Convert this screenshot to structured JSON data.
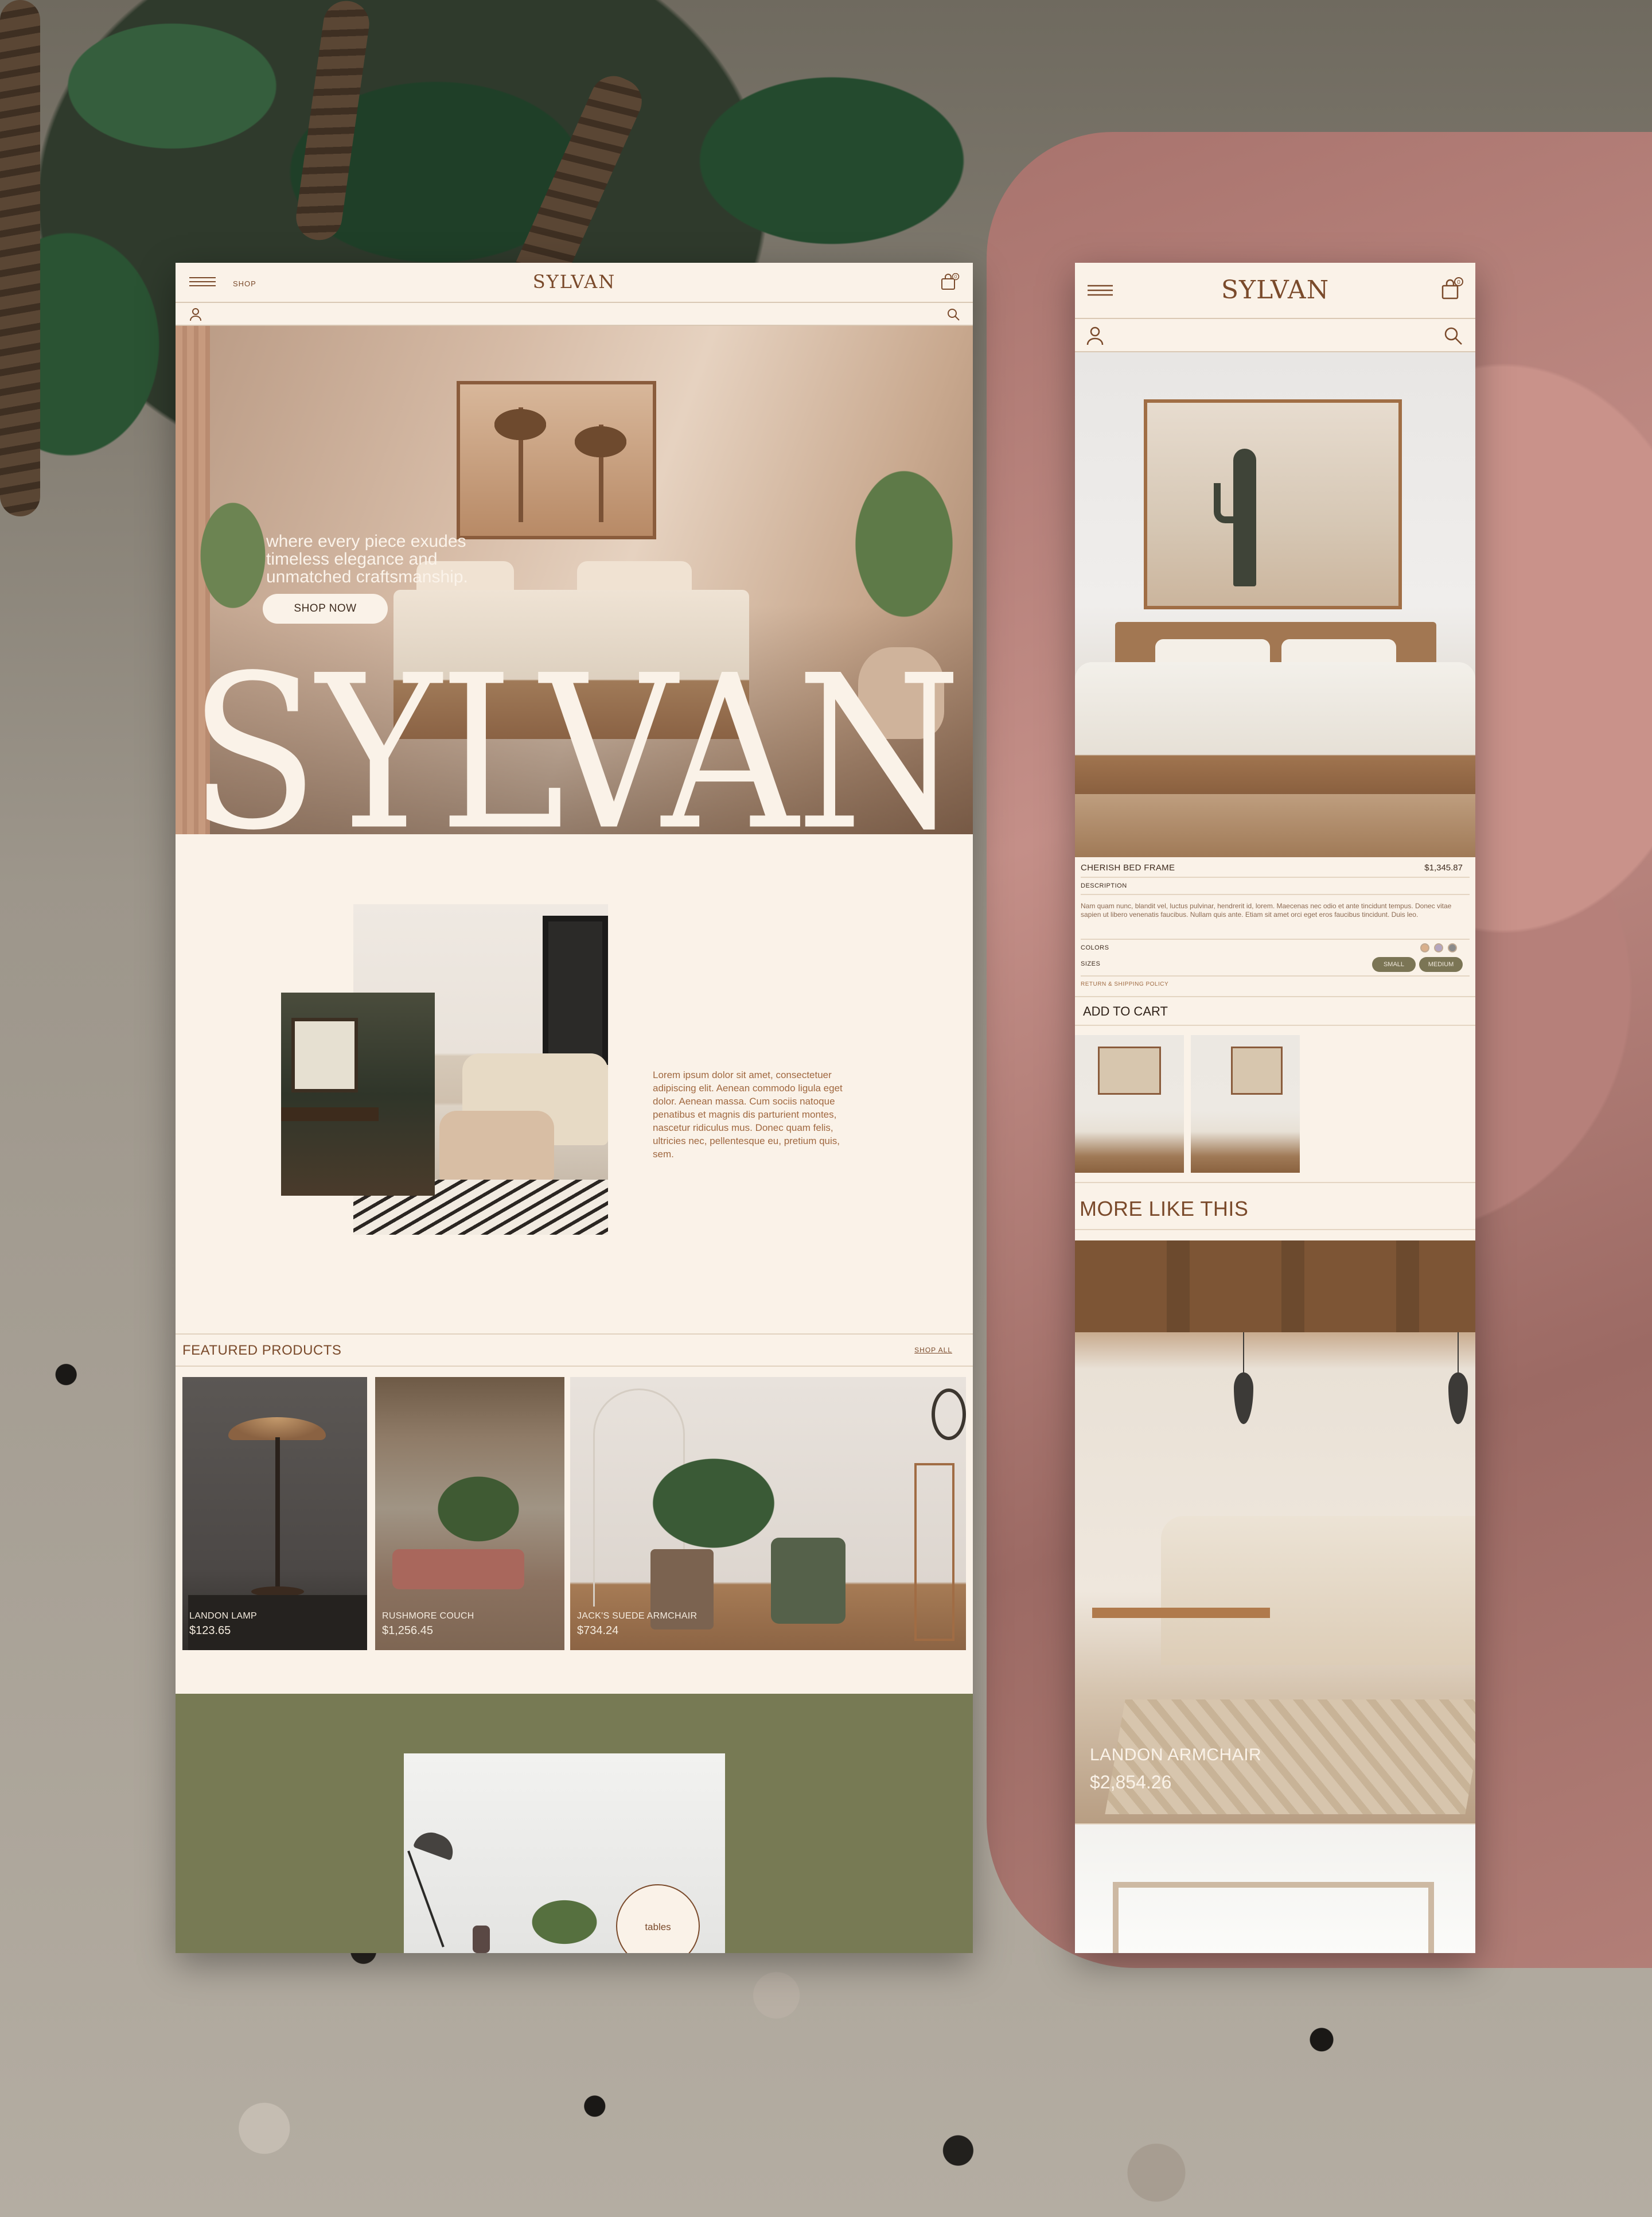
{
  "colors": {
    "cream": "#faf2e8",
    "brown_accent": "#7a4a2b",
    "olive": "#777a54",
    "size_chip": "#7b7555"
  },
  "desktop": {
    "topbar": {
      "menu_icon": "hamburger-menu-icon",
      "shop_label": "SHOP",
      "logo": "SYLVAN",
      "cart_icon": "shopping-bag-icon",
      "cart_count": "0"
    },
    "iconbar": {
      "user_icon": "user-icon",
      "search_icon": "search-icon"
    },
    "hero": {
      "tagline": "where every piece exudes timeless elegance and unmatched craftsmanship.",
      "cta_label": "SHOP NOW",
      "wordmark": "SYLVAN"
    },
    "about": {
      "body": "Lorem ipsum dolor sit amet, consectetuer adipiscing elit. Aenean commodo ligula eget dolor. Aenean massa. Cum sociis natoque penatibus et magnis dis parturient montes, nascetur ridiculus mus. Donec quam felis, ultricies nec, pellentesque eu, pretium quis, sem."
    },
    "featured": {
      "title": "FEATURED PRODUCTS",
      "shop_all": "SHOP ALL",
      "products": [
        {
          "name": "LANDON LAMP",
          "price": "$123.65"
        },
        {
          "name": "RUSHMORE COUCH",
          "price": "$1,256.45"
        },
        {
          "name": "JACK'S SUEDE ARMCHAIR",
          "price": "$734.24"
        }
      ]
    },
    "category": {
      "label": "tables"
    }
  },
  "mobile": {
    "topbar": {
      "menu_icon": "hamburger-menu-icon",
      "logo": "SYLVAN",
      "cart_icon": "shopping-bag-icon",
      "cart_count": "0"
    },
    "iconbar": {
      "user_icon": "user-icon",
      "search_icon": "search-icon"
    },
    "product": {
      "name": "CHERISH BED FRAME",
      "price": "$1,345.87",
      "description_label": "DESCRIPTION",
      "description": "Nam quam nunc, blandit vel, luctus pulvinar, hendrerit id, lorem. Maecenas nec odio et ante tincidunt tempus. Donec vitae sapien ut libero venenatis faucibus. Nullam quis ante. Etiam sit amet orci eget eros faucibus tincidunt. Duis leo.",
      "colors_label": "COLORS",
      "swatches": [
        "#d9b08c",
        "#b4a6bf",
        "#8a8a8a"
      ],
      "sizes_label": "SIZES",
      "sizes": [
        "SMALL",
        "MEDIUM"
      ],
      "policy_link": "RETURN & SHIPPING POLICY",
      "add_to_cart": "ADD TO CART"
    },
    "more_like_this": {
      "title": "MORE LIKE THIS",
      "item": {
        "name": "LANDON ARMCHAIR",
        "price": "$2,854.26"
      }
    }
  }
}
